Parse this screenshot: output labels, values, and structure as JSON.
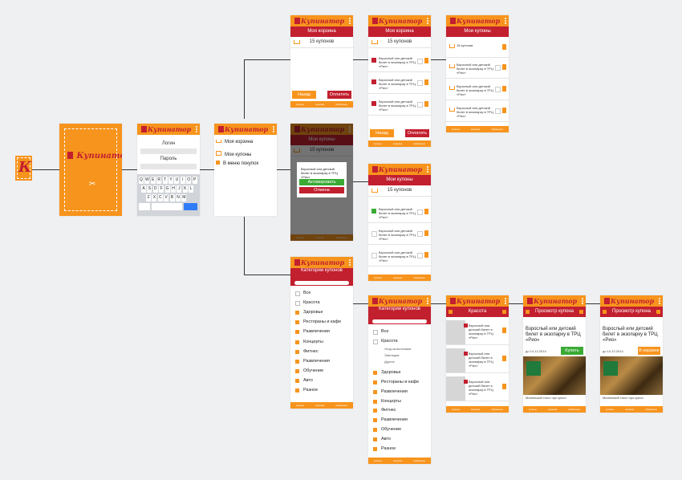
{
  "app": {
    "logo_text": "Купинатор",
    "logo_letter": "К",
    "colors": {
      "orange": "#f7941d",
      "red": "#c21f2f",
      "green": "#3aaa35",
      "bg": "#eff0f2"
    }
  },
  "login": {
    "login_label": "Логин",
    "password_label": "Пароль",
    "keyboard_rows": [
      "QWERTYUIOP",
      "ASDFGHJKL",
      "ZXCVBNM"
    ],
    "key_123": "#123",
    "key_space": "space",
    "key_search": "Search"
  },
  "menu": {
    "items": [
      "Моя корзина",
      "Мои купоны",
      "В меню покупок"
    ]
  },
  "cart": {
    "title": "Моя корзина",
    "count": "15 купонов",
    "back": "Назад",
    "pay": "Оплатить"
  },
  "coupons": {
    "title": "Мои купоны",
    "count": "15 купонов",
    "item_text": "Взрослый или детский билет в экзопарку в ТРЦ «Рио»"
  },
  "dialog": {
    "text": "Взрослый или детский билет в экзопарку в ТРЦ «Рио»",
    "activate": "Активировать",
    "cancel": "Отмена"
  },
  "categories": {
    "title": "Категории купонов",
    "items": [
      "Все",
      "Красота",
      "Здоровье",
      "Рестораны и кафе",
      "Развлечения",
      "Концерты",
      "Фитнес",
      "Развлечения",
      "Обучение",
      "Авто",
      "Разное"
    ],
    "sub_items": [
      "Уход за волосами",
      "Эпиляция",
      "Другое"
    ]
  },
  "beauty": {
    "title": "Красота"
  },
  "view": {
    "title": "Просмотр купона",
    "headline": "Взрослый или детский билет в экзопарку в ТРЦ «Рио»",
    "date": "до 14.12.2014",
    "buy": "Купить",
    "to_cart": "В корзине",
    "desc": "Маленький текст про купон"
  },
  "footer": {
    "items": [
      "купоны",
      "корзина",
      "избранное"
    ]
  }
}
